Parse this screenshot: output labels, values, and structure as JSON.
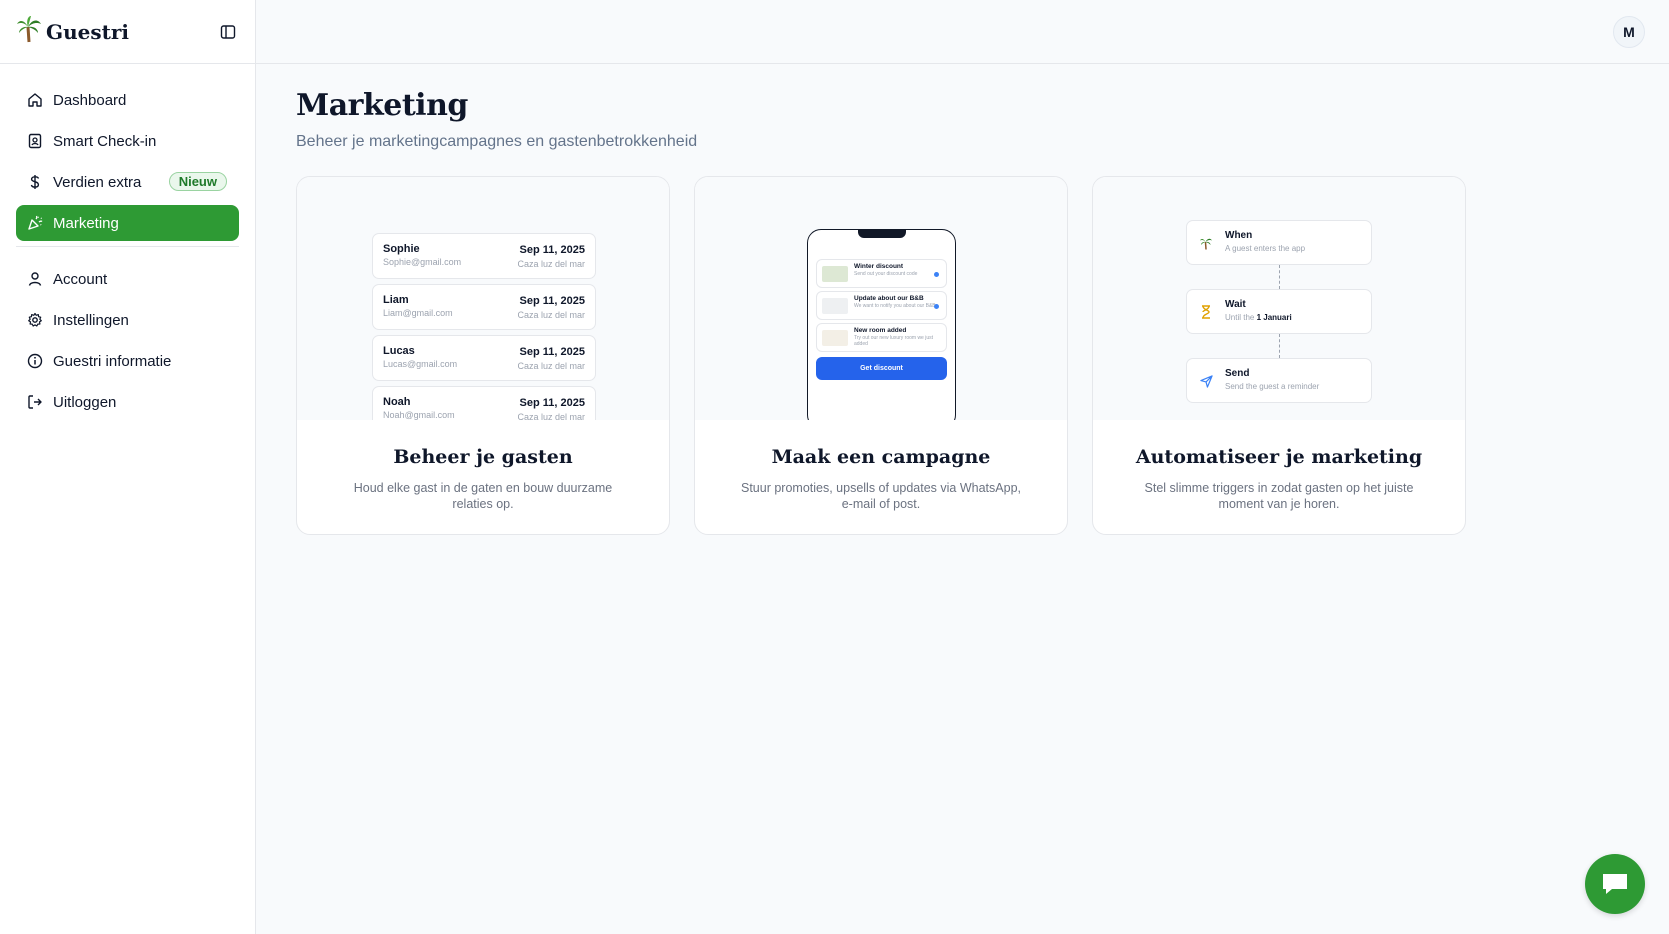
{
  "brand": {
    "name": "Guestri"
  },
  "nav": {
    "items": [
      {
        "label": "Dashboard",
        "icon": "home-icon"
      },
      {
        "label": "Smart Check-in",
        "icon": "badge-id-icon"
      },
      {
        "label": "Verdien extra",
        "icon": "dollar-icon",
        "badge": "Nieuw"
      },
      {
        "label": "Marketing",
        "icon": "party-popper-icon",
        "active": true
      }
    ],
    "secondary": [
      {
        "label": "Account",
        "icon": "user-icon"
      },
      {
        "label": "Instellingen",
        "icon": "gear-icon"
      },
      {
        "label": "Guestri informatie",
        "icon": "info-icon"
      },
      {
        "label": "Uitloggen",
        "icon": "logout-icon"
      }
    ]
  },
  "topbar": {
    "avatar_initial": "M"
  },
  "page": {
    "title": "Marketing",
    "subtitle": "Beheer je marketingcampagnes en gastenbetrokkenheid"
  },
  "cards": [
    {
      "title": "Beheer je gasten",
      "desc": "Houd elke gast in de gaten en bouw duurzame relaties op.",
      "guests": [
        {
          "name": "Sophie",
          "email": "Sophie@gmail.com",
          "date": "Sep 11, 2025",
          "place": "Caza luz del mar"
        },
        {
          "name": "Liam",
          "email": "Liam@gmail.com",
          "date": "Sep 11, 2025",
          "place": "Caza luz del mar"
        },
        {
          "name": "Lucas",
          "email": "Lucas@gmail.com",
          "date": "Sep 11, 2025",
          "place": "Caza luz del mar"
        },
        {
          "name": "Noah",
          "email": "Noah@gmail.com",
          "date": "Sep 11, 2025",
          "place": "Caza luz del mar"
        }
      ]
    },
    {
      "title": "Maak een campagne",
      "desc": "Stuur promoties, upsells of updates via WhatsApp, e-mail of post.",
      "phone": {
        "items": [
          {
            "title": "Winter discount",
            "sub": "Send out your discount code"
          },
          {
            "title": "Update about our B&B",
            "sub": "We want to notify you about our B&B"
          },
          {
            "title": "New room added",
            "sub": "Try out our new luxury room we just added"
          }
        ],
        "button": "Get discount"
      }
    },
    {
      "title": "Automatiseer je marketing",
      "desc": "Stel slimme triggers in zodat gasten op het juiste moment van je horen.",
      "flow": [
        {
          "title": "When",
          "sub": "A guest enters the app"
        },
        {
          "title": "Wait",
          "sub_prefix": "Until the ",
          "sub_bold": "1 Januari"
        },
        {
          "title": "Send",
          "sub": "Send the guest a reminder"
        }
      ]
    }
  ],
  "colors": {
    "accent": "#2e9a34",
    "campaign_button": "#2563eb",
    "badge_bg": "#eaf7ec"
  }
}
